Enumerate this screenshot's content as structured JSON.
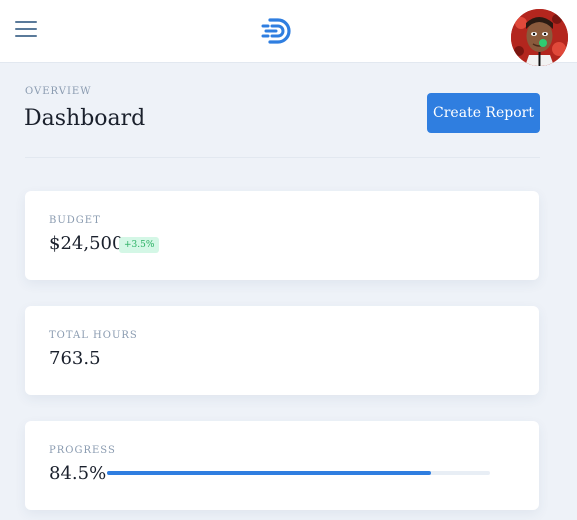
{
  "header": {
    "menu_icon": "hamburger-menu-icon",
    "logo_icon": "brand-d-logo-icon",
    "avatar": "user-avatar"
  },
  "page": {
    "overview_label": "OVERVIEW",
    "title": "Dashboard",
    "create_button_label": "Create Report"
  },
  "cards": {
    "budget": {
      "label": "BUDGET",
      "value": "$24,500",
      "change": "+3.5%"
    },
    "hours": {
      "label": "TOTAL HOURS",
      "value": "763.5"
    },
    "progress": {
      "label": "PROGRESS",
      "value": "84.5%",
      "fraction": 0.845
    }
  },
  "colors": {
    "accent": "#2f7ee0",
    "badge_bg": "#d4f7e6",
    "badge_text": "#27ae60",
    "page_bg": "#eef2f8"
  }
}
